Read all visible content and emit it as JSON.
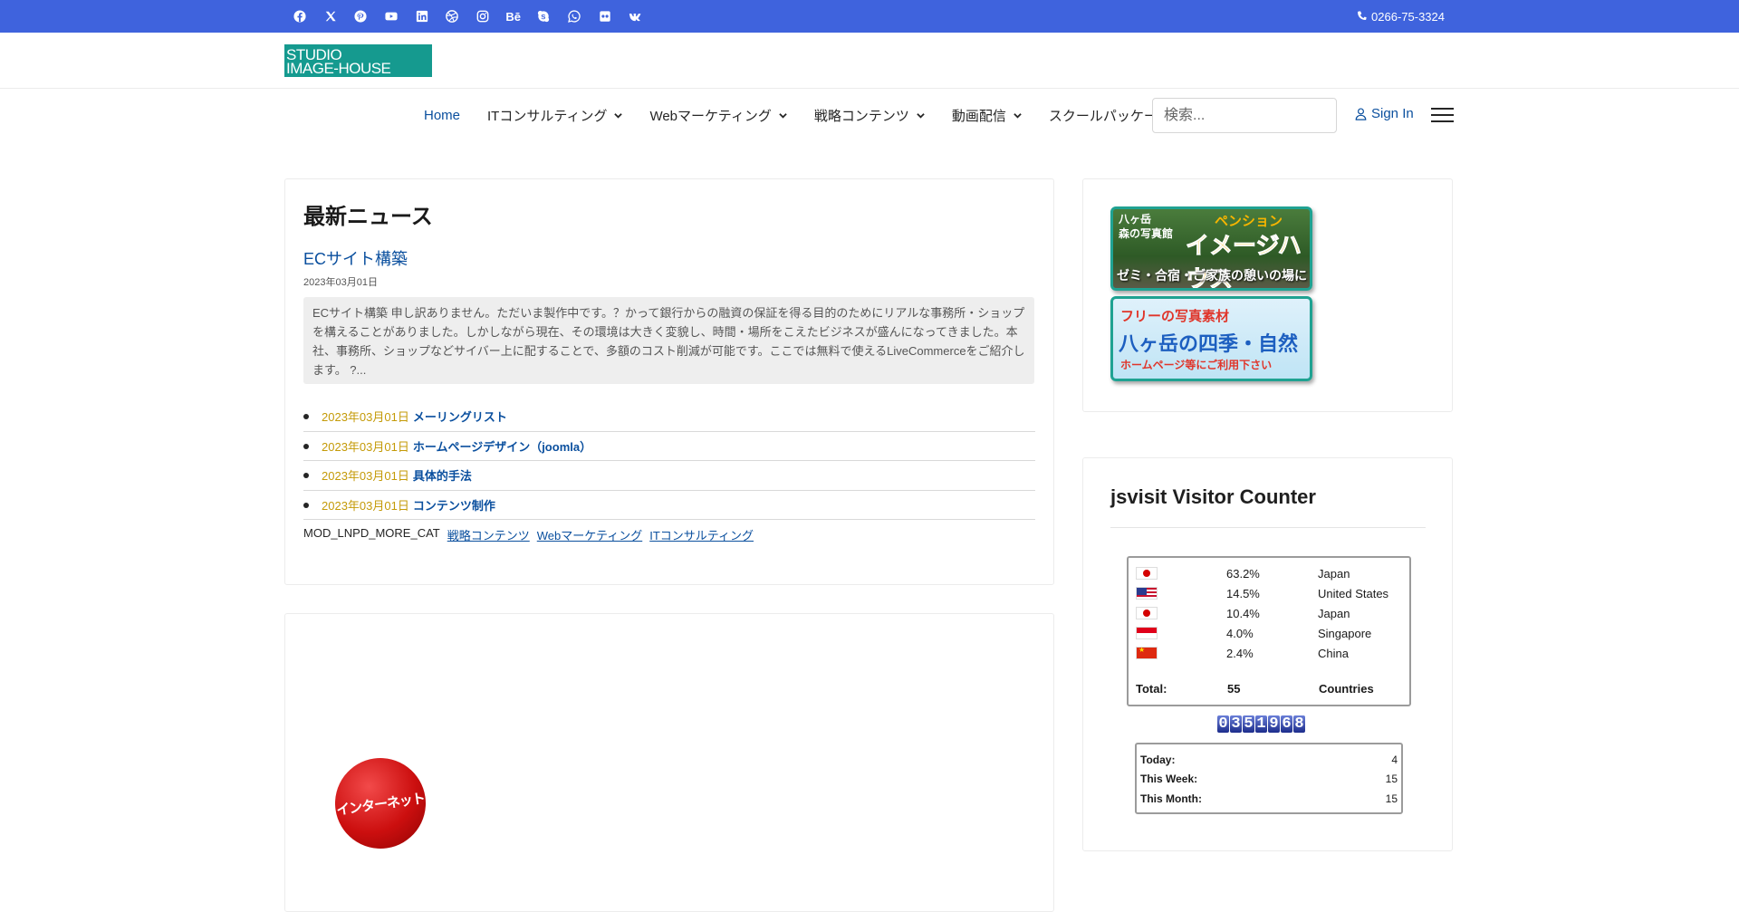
{
  "topbar": {
    "social_icons": [
      "facebook-icon",
      "x-icon",
      "pinterest-icon",
      "youtube-icon",
      "linkedin-icon",
      "dribbble-icon",
      "instagram-icon",
      "behance-icon",
      "skype-icon",
      "whatsapp-icon",
      "flickr-icon",
      "vk-icon"
    ],
    "behance_glyph": "Bē",
    "phone": "0266-75-3324",
    "bg_color": "#3f63dd"
  },
  "header": {
    "logo_line1": "STUDIO",
    "logo_line2": "IMAGE-HOUSE",
    "nav": [
      {
        "label": "Home"
      },
      {
        "label": "ITコンサルティング"
      },
      {
        "label": "Webマーケティング"
      },
      {
        "label": "戦略コンテンツ"
      },
      {
        "label": "動画配信"
      },
      {
        "label": "スクールパッケージ"
      }
    ],
    "search_placeholder": "検索...",
    "signin": "Sign In"
  },
  "news": {
    "title": "最新ニュース",
    "lead_title": "ECサイト構築",
    "lead_date": "2023年03月01日",
    "lead_intro": "ECサイト構築 申し訳ありません。ただいま製作中です。？かって銀行からの融資の保証を得る目的のためにリアルな事務所・ショップを構えることがありました。しかしながら現在、その環境は大きく変貌し、時間・場所をこえたビジネスが盛んになってきました。本社、事務所、ショップなどサイバー上に配することで、多額のコスト削減が可能です。ここでは無料で使えるLiveCommerceをご紹介します。 ?...",
    "items": [
      {
        "date": "2023年03月01日",
        "title": "メーリングリスト"
      },
      {
        "date": "2023年03月01日",
        "title": "ホームページデザイン（joomla）"
      },
      {
        "date": "2023年03月01日",
        "title": "具体的手法"
      },
      {
        "date": "2023年03月01日",
        "title": "コンテンツ制作"
      }
    ],
    "more_cat_label": "MOD_LNPD_MORE_CAT",
    "more_cats": [
      "戦略コンテンツ",
      "Webマーケティング",
      "ITコンサルティング"
    ]
  },
  "ball_text": "インターネット",
  "banners": {
    "b1_small_1": "八ヶ岳",
    "b1_small_2": "森の写真館",
    "b1_big_1": "ペンション",
    "b1_big_2": "イメージハウス",
    "b1_sub": "ゼミ・合宿・ご家族の憩いの場に",
    "b2_top": "フリーの写真素材",
    "b2_mid": "八ヶ岳の四季・自然",
    "b2_bot": "ホームページ等にご利用下さい"
  },
  "counter": {
    "title": "jsvisit Visitor Counter",
    "countries": [
      {
        "flag": "jp",
        "pct": "63.2%",
        "name": "Japan"
      },
      {
        "flag": "us",
        "pct": "14.5%",
        "name": "United States"
      },
      {
        "flag": "jp",
        "pct": "10.4%",
        "name": "Japan"
      },
      {
        "flag": "sg",
        "pct": "4.0%",
        "name": "Singapore"
      },
      {
        "flag": "cn",
        "pct": "2.4%",
        "name": "China"
      }
    ],
    "total_label": "Total:",
    "total_value": "55",
    "total_unit": "Countries",
    "digits": [
      "0",
      "3",
      "5",
      "1",
      "9",
      "6",
      "8"
    ],
    "stats": [
      {
        "label": "Today:",
        "value": "4"
      },
      {
        "label": "This Week:",
        "value": "15"
      },
      {
        "label": "This Month:",
        "value": "15"
      }
    ]
  }
}
